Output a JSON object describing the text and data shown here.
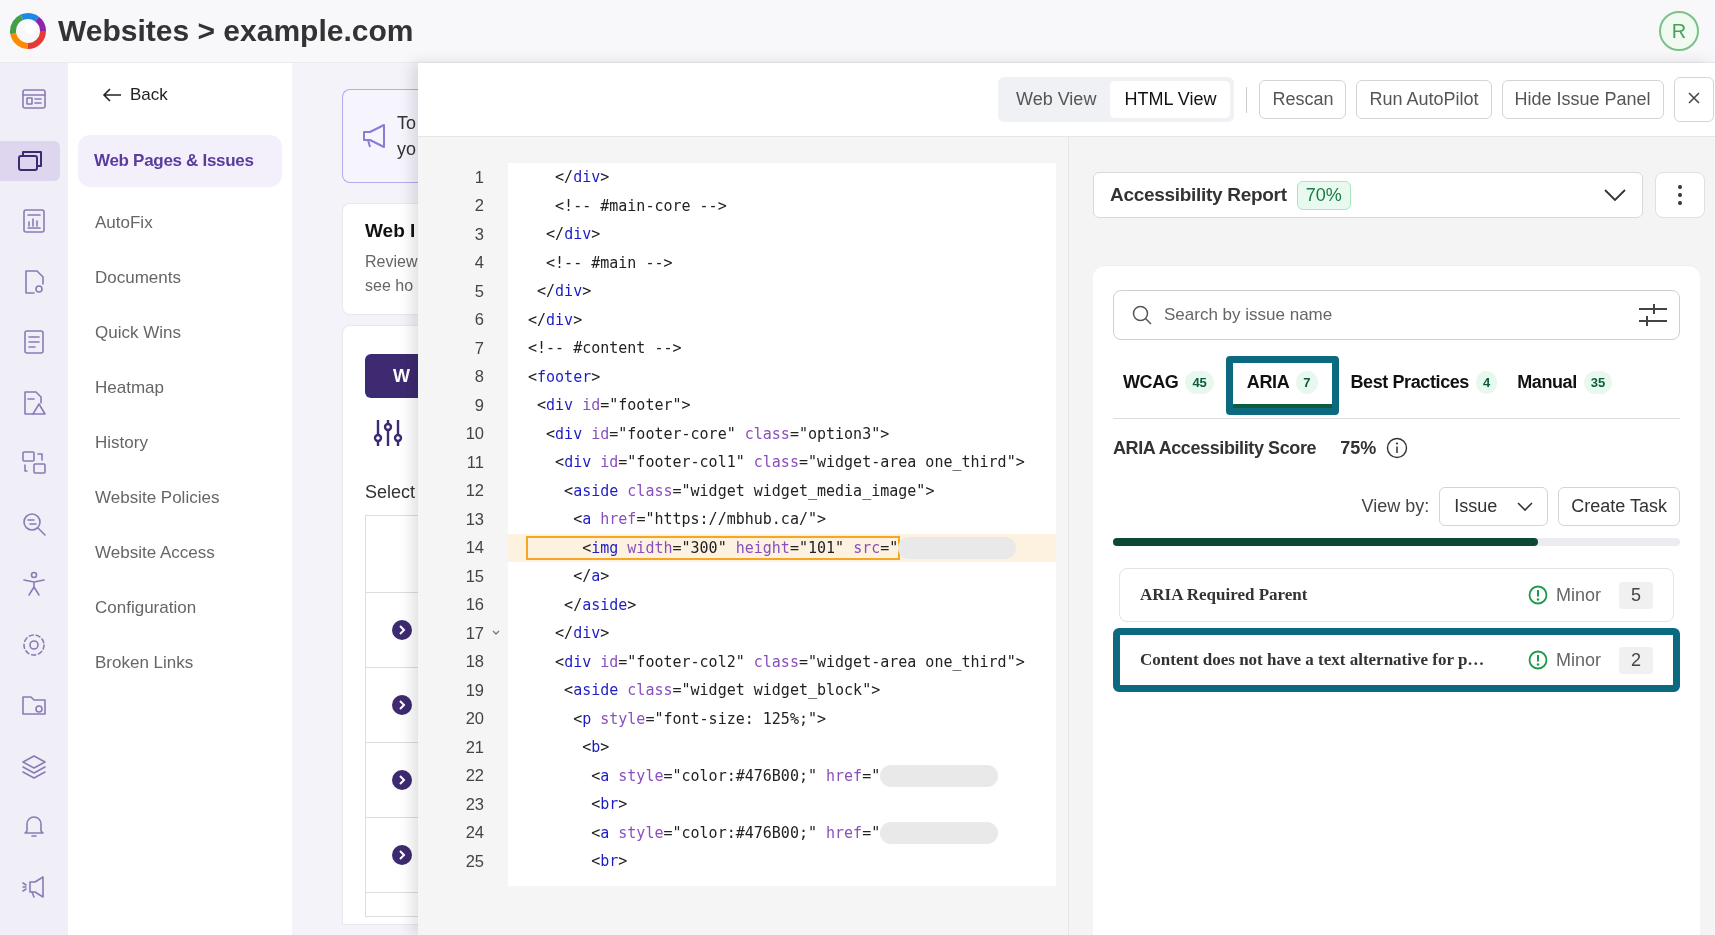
{
  "header": {
    "title": "Websites > example.com",
    "avatar": "R"
  },
  "rail": [
    {
      "kind": "dashboard",
      "selected": false
    },
    {
      "kind": "windows",
      "selected": true
    },
    {
      "kind": "report",
      "selected": false
    },
    {
      "kind": "doc-gear",
      "selected": false
    },
    {
      "kind": "notes",
      "selected": false
    },
    {
      "kind": "doc-warning",
      "selected": false
    },
    {
      "kind": "transfer",
      "selected": false
    },
    {
      "kind": "search",
      "selected": false
    },
    {
      "kind": "person",
      "selected": false
    },
    {
      "kind": "gear",
      "selected": false
    },
    {
      "kind": "folder",
      "selected": false
    },
    {
      "kind": "layers",
      "selected": false
    },
    {
      "kind": "bell",
      "selected": false
    },
    {
      "kind": "megaphone",
      "selected": false
    }
  ],
  "nav": {
    "back": "Back",
    "items": [
      {
        "label": "Web Pages & Issues",
        "selected": true
      },
      {
        "label": "AutoFix",
        "selected": false
      },
      {
        "label": "Documents",
        "selected": false
      },
      {
        "label": "Quick Wins",
        "selected": false
      },
      {
        "label": "Heatmap",
        "selected": false
      },
      {
        "label": "History",
        "selected": false
      },
      {
        "label": "Website Policies",
        "selected": false
      },
      {
        "label": "Website Access",
        "selected": false
      },
      {
        "label": "Configuration",
        "selected": false
      },
      {
        "label": "Broken Links",
        "selected": false
      }
    ]
  },
  "background": {
    "banner_lines": [
      "To",
      "yo"
    ],
    "card_title": "Web I",
    "card_lines": [
      "Review",
      "see ho"
    ],
    "button": "W",
    "select_label": "Select"
  },
  "toolbar": {
    "views": [
      {
        "label": "Web View",
        "selected": false
      },
      {
        "label": "HTML View",
        "selected": true
      }
    ],
    "buttons": [
      "Rescan",
      "Run AutoPilot",
      "Hide Issue Panel"
    ]
  },
  "code": {
    "lines": [
      {
        "number": "1",
        "text": "   </div>"
      },
      {
        "number": "2",
        "text": "   <!-- #main-core -->"
      },
      {
        "number": "3",
        "text": "  </div>"
      },
      {
        "number": "4",
        "text": "  <!-- #main -->"
      },
      {
        "number": "5",
        "text": " </div>"
      },
      {
        "number": "6",
        "text": "</div>"
      },
      {
        "number": "7",
        "text": "<!-- #content -->"
      },
      {
        "number": "8",
        "text": "<footer>"
      },
      {
        "number": "9",
        "text": " <div id=\"footer\">"
      },
      {
        "number": "10",
        "text": "  <div id=\"footer-core\" class=\"option3\">"
      },
      {
        "number": "11",
        "text": "   <div id=\"footer-col1\" class=\"widget-area one_third\">"
      },
      {
        "number": "12",
        "text": "    <aside class=\"widget widget_media_image\">"
      },
      {
        "number": "13",
        "text": "     <a href=\"https://mbhub.ca/\">"
      },
      {
        "number": "14",
        "text": "      <img width=\"300\" height=\"101\" src=\"",
        "highlighted": true,
        "redacted": true
      },
      {
        "number": "15",
        "text": "     </a>"
      },
      {
        "number": "16",
        "text": "    </aside>"
      },
      {
        "number": "17",
        "text": "   </div>",
        "foldable": true
      },
      {
        "number": "18",
        "text": "   <div id=\"footer-col2\" class=\"widget-area one_third\">"
      },
      {
        "number": "19",
        "text": "    <aside class=\"widget widget_block\">"
      },
      {
        "number": "20",
        "text": "     <p style=\"font-size: 125%;\">"
      },
      {
        "number": "21",
        "text": "      <b>"
      },
      {
        "number": "22",
        "text": "       <a style=\"color:#476B00;\" href=\"",
        "redacted": true
      },
      {
        "number": "23",
        "text": "       <br>"
      },
      {
        "number": "24",
        "text": "       <a style=\"color:#476B00;\" href=\"",
        "redacted": true
      },
      {
        "number": "25",
        "text": "       <br>"
      }
    ]
  },
  "report": {
    "title": "Accessibility Report",
    "score": "70%"
  },
  "issues_panel": {
    "search": {
      "placeholder": "Search by issue name"
    },
    "tabs": [
      {
        "label": "WCAG",
        "count": "45",
        "selected": false,
        "annotated": false
      },
      {
        "label": "ARIA",
        "count": "7",
        "selected": true,
        "annotated": true
      },
      {
        "label": "Best Practices",
        "count": "4",
        "selected": false,
        "annotated": false
      },
      {
        "label": "Manual",
        "count": "35",
        "selected": false,
        "annotated": false
      }
    ],
    "score_label": "ARIA Accessibility Score",
    "score": "75%",
    "view_by_label": "View by:",
    "view_by": "Issue",
    "create_task": "Create Task",
    "level": 0.75,
    "issues": [
      {
        "title": "ARIA Required Parent",
        "severity": "Minor",
        "count": "5",
        "annotated": false
      },
      {
        "title": "Content does not have a text alternative for p…",
        "severity": "Minor",
        "count": "2",
        "annotated": true
      }
    ]
  }
}
